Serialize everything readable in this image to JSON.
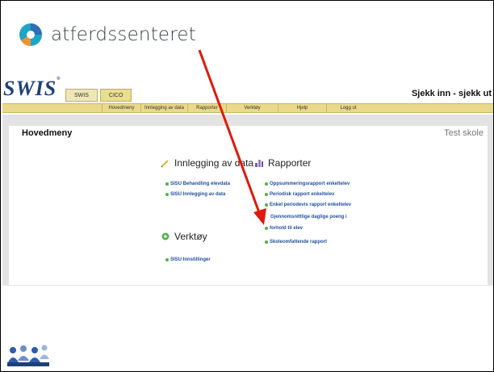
{
  "brand": {
    "org_name": "atferdssenteret",
    "colors": {
      "teal": "#1fa3c7",
      "blue": "#2f6fb4",
      "orange": "#f0912e"
    }
  },
  "app": {
    "name": "SWIS",
    "trademark": "®",
    "tabs": [
      {
        "label": "SWIS",
        "active": false
      },
      {
        "label": "CICO",
        "active": true
      }
    ],
    "greeting": "Sjekk inn - sjekk ut",
    "menu": [
      "Hovedmeny",
      "Innlegging av data",
      "Rapporter",
      "Verktøy",
      "Hjelp",
      "Logg ut"
    ]
  },
  "main": {
    "title": "Hovedmeny",
    "school": "Test skole",
    "sections": {
      "data_entry": {
        "title": "Innlegging av data",
        "icon": "pencil-icon",
        "links": [
          "SISU Behandling elevdata",
          "SISU Innlegging av data"
        ]
      },
      "reports": {
        "title": "Rapporter",
        "icon": "chart-icon",
        "links": [
          "Oppsummeringsrapport enkeltelev",
          "Periodisk rapport enkeltelev",
          "Enkel periodevis rapport enkeltelev",
          "Gjennomsnittlige daglige poeng i",
          "forhold til elev",
          "Skoleomfattende rapport"
        ]
      },
      "tools": {
        "title": "Verktøy",
        "icon": "gear-icon",
        "links": [
          "SISU Innstillinger"
        ]
      }
    }
  },
  "annotation": {
    "type": "arrow",
    "color": "#e0190c"
  }
}
